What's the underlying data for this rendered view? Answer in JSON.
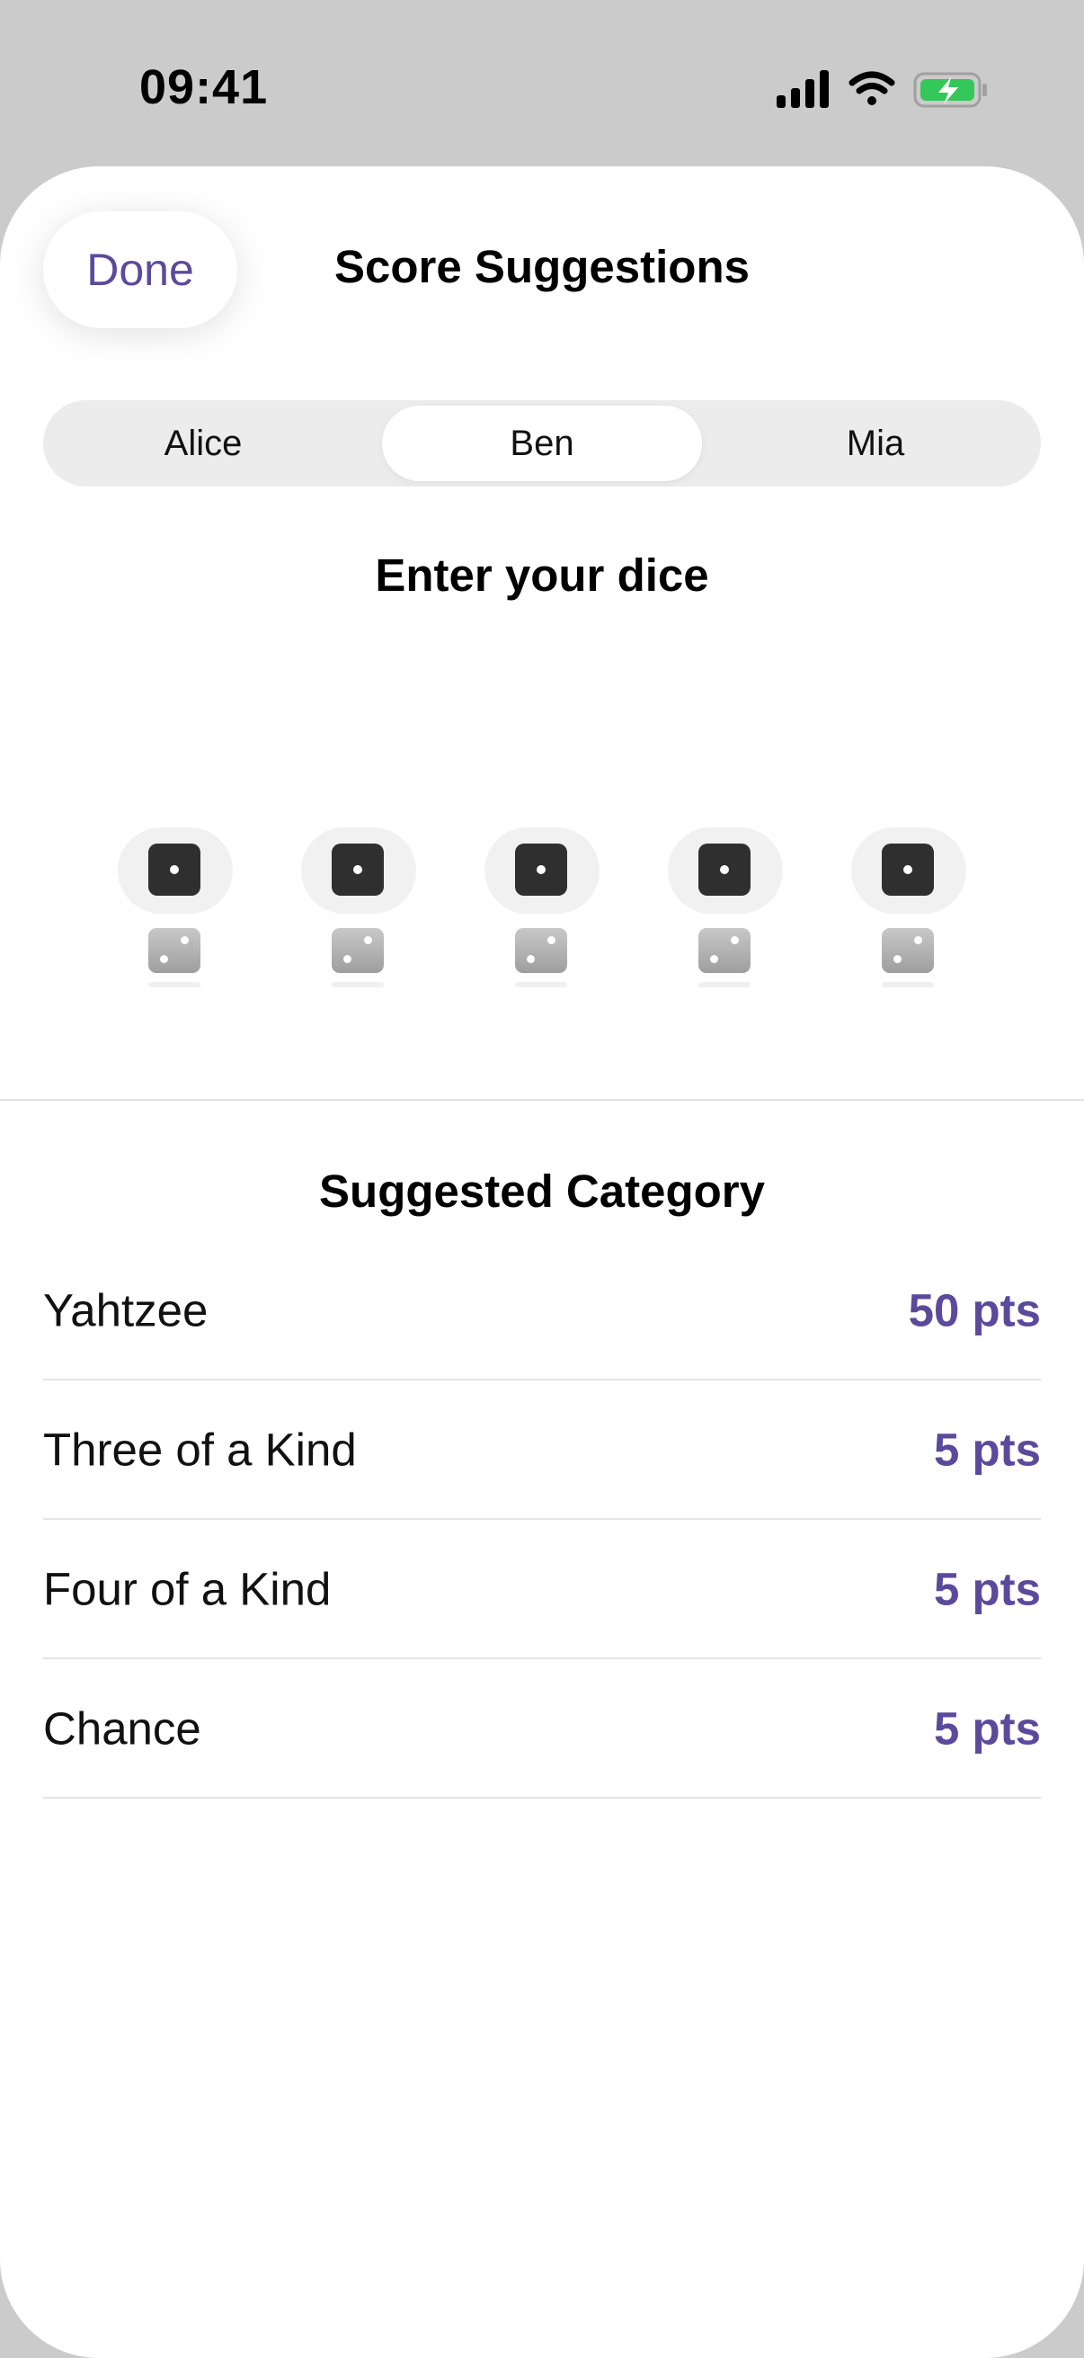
{
  "status_bar": {
    "time": "09:41",
    "icons": [
      "cellular-signal-icon",
      "wifi-icon",
      "battery-charging-icon"
    ],
    "battery_color": "#34c759"
  },
  "header": {
    "done_label": "Done",
    "title": "Score Suggestions"
  },
  "players": {
    "tabs": [
      {
        "label": "Alice",
        "selected": false
      },
      {
        "label": "Ben",
        "selected": true
      },
      {
        "label": "Mia",
        "selected": false
      }
    ]
  },
  "dice_entry": {
    "title": "Enter your dice",
    "dice": [
      {
        "value": 1,
        "next": 2
      },
      {
        "value": 1,
        "next": 2
      },
      {
        "value": 1,
        "next": 2
      },
      {
        "value": 1,
        "next": 2
      },
      {
        "value": 1,
        "next": 2
      }
    ]
  },
  "suggestions": {
    "title": "Suggested Category",
    "items": [
      {
        "category": "Yahtzee",
        "points": "50 pts"
      },
      {
        "category": "Three of a Kind",
        "points": "5 pts"
      },
      {
        "category": "Four of a Kind",
        "points": "5 pts"
      },
      {
        "category": "Chance",
        "points": "5 pts"
      }
    ]
  },
  "colors": {
    "accent": "#5b4a9c",
    "sheet_background": "#ffffff",
    "backdrop": "#cbcbcb"
  }
}
